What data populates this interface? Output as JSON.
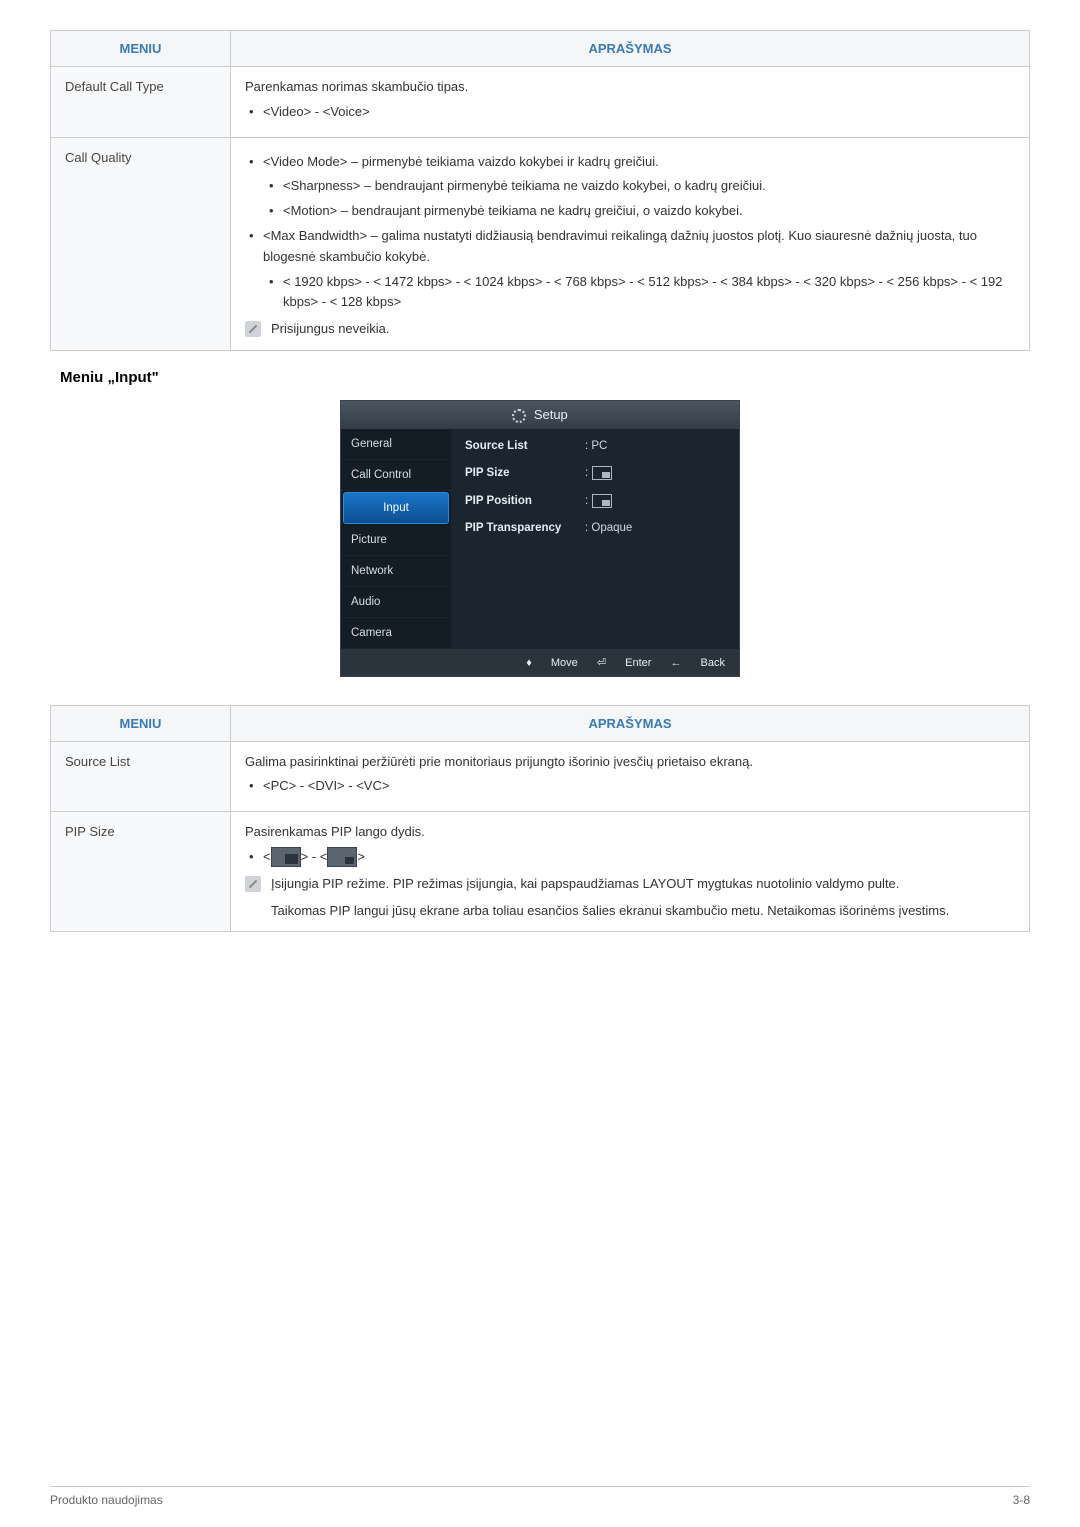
{
  "table1": {
    "header_meniu": "MENIU",
    "header_aprasymas": "APRAŠYMAS",
    "rows": [
      {
        "label": "Default Call Type",
        "intro": "Parenkamas norimas skambučio tipas.",
        "bullet1": "<Video> - <Voice>"
      },
      {
        "label": "Call Quality",
        "b1": "<Video Mode> – pirmenybė teikiama vaizdo kokybei ir kadrų greičiui.",
        "b1a": "<Sharpness> – bendraujant pirmenybė teikiama ne vaizdo kokybei, o kadrų greičiui.",
        "b1b": "<Motion> – bendraujant pirmenybė teikiama ne kadrų greičiui, o vaizdo kokybei.",
        "b2": "<Max Bandwidth> – galima nustatyti didžiausią bendravimui reikalingą dažnių juostos plotį. Kuo siauresnė dažnių juosta, tuo blogesnė skambučio kokybė.",
        "b2a": "< 1920 kbps> - < 1472 kbps> - < 1024 kbps> - < 768 kbps> - < 512 kbps> - < 384 kbps> - < 320 kbps> - < 256 kbps> - < 192 kbps> - < 128 kbps>",
        "note": "Prisijungus neveikia."
      }
    ]
  },
  "heading_input": "Meniu „Input\"",
  "setup": {
    "title": "Setup",
    "sidebar": [
      "General",
      "Call Control",
      "Input",
      "Picture",
      "Network",
      "Audio",
      "Camera"
    ],
    "active_index": 2,
    "rows": [
      {
        "label": "Source List",
        "value": ": PC"
      },
      {
        "label": "PIP Size",
        "value": ":"
      },
      {
        "label": "PIP Position",
        "value": ":"
      },
      {
        "label": "PIP Transparency",
        "value": ": Opaque"
      }
    ],
    "footer_move": "Move",
    "footer_enter": "Enter",
    "footer_back": "Back"
  },
  "table2": {
    "header_meniu": "MENIU",
    "header_aprasymas": "APRAŠYMAS",
    "rows": [
      {
        "label": "Source List",
        "intro": "Galima pasirinktinai peržiūrėti prie monitoriaus prijungto išorinio įvesčių prietaiso ekraną.",
        "bullet1": "<PC> - <DVI> - <VC>"
      },
      {
        "label": "PIP Size",
        "intro": "Pasirenkamas PIP lango dydis.",
        "note1": "Įsijungia PIP režime. PIP režimas įsijungia, kai papspaudžiamas LAYOUT mygtukas nuotolinio valdymo pulte.",
        "note2": "Taikomas PIP langui jūsų ekrane arba toliau esančios šalies ekranui skambučio metu. Netaikomas išorinėms įvestims."
      }
    ]
  },
  "footer_left": "Produkto naudojimas",
  "footer_right": "3-8"
}
